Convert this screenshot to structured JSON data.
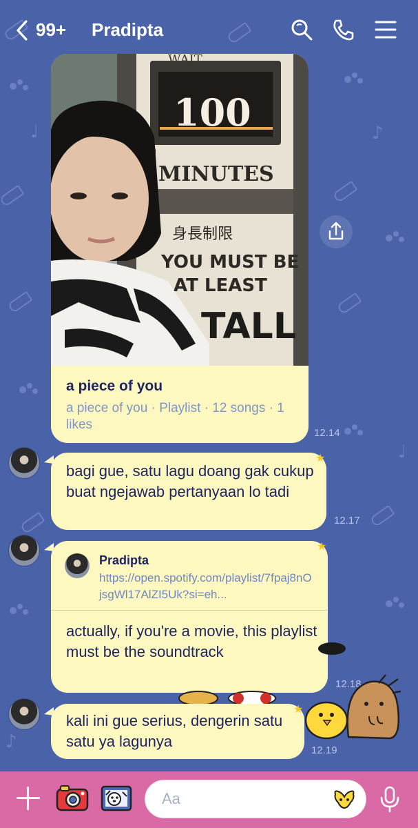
{
  "header": {
    "unread_count": "99+",
    "title": "Pradipta"
  },
  "messages": {
    "playlist_card": {
      "title": "a piece of you",
      "subtitle": "a piece of you · Playlist · 12 songs · 1 likes",
      "time": "12.14"
    },
    "msg1": {
      "text": "bagi gue, satu lagu doang gak cukup buat ngejawab pertanyaan lo tadi",
      "time": "12.17"
    },
    "msg2": {
      "sender": "Pradipta",
      "url": "https://open.spotify.com/playlist/7fpaj8nOjsgWl17AlZI5Uk?si=eh...",
      "text": "actually, if you're a movie, this playlist must be the soundtrack",
      "time": "12.18"
    },
    "msg3": {
      "text": "kali ini gue serius, dengerin satu satu ya lagunya",
      "time": "12.19"
    }
  },
  "photo": {
    "sign_top": "WAIT",
    "counter": "100",
    "minutes": "MINUTES",
    "jp": "身長制限",
    "line1": "YOU MUST BE",
    "line2": "AT LEAST",
    "line3": "TALL"
  },
  "input": {
    "placeholder": "Aa"
  },
  "colors": {
    "background": "#4a62a8",
    "bubble": "#fdf7c0",
    "bottom_bar": "#d96aa6"
  }
}
